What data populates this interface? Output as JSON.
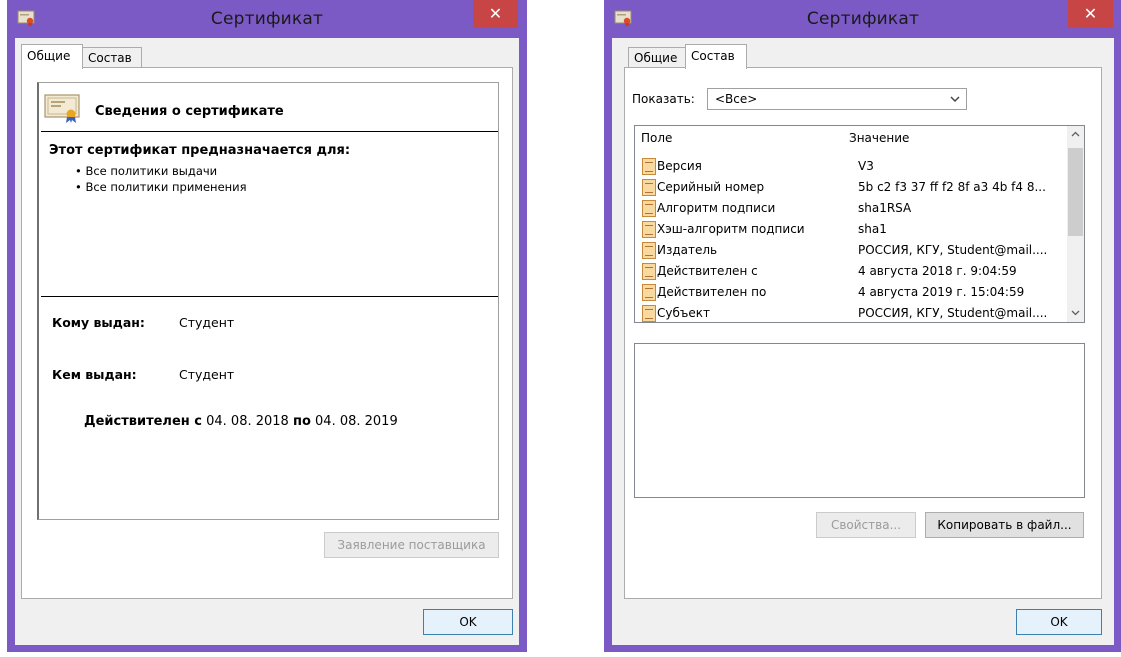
{
  "left_dialog": {
    "title": "Сертификат",
    "close_glyph": "✕",
    "tabs": [
      {
        "label": "Общие",
        "active": true
      },
      {
        "label": "Состав",
        "active": false
      }
    ],
    "info_heading": "Сведения о сертификате",
    "purpose_heading": "Этот сертификат предназначается для:",
    "purposes": [
      "• Все политики выдачи",
      "• Все политики применения"
    ],
    "issued_to_label": "Кому выдан:",
    "issued_to_value": "Студент",
    "issued_by_label": "Кем выдан:",
    "issued_by_value": "Студент",
    "valid_from_label": "Действителен с",
    "valid_from_value": "04. 08. 2018",
    "valid_to_label": "по",
    "valid_to_value": "04. 08. 2019",
    "issuer_statement_button": "Заявление поставщика",
    "ok_button": "OK"
  },
  "right_dialog": {
    "title": "Сертификат",
    "close_glyph": "✕",
    "tabs": [
      {
        "label": "Общие",
        "active": false
      },
      {
        "label": "Состав",
        "active": true
      }
    ],
    "show_label": "Показать:",
    "show_selected": "<Все>",
    "columns": [
      "Поле",
      "Значение"
    ],
    "rows": [
      {
        "field": "Версия",
        "value": "V3"
      },
      {
        "field": "Серийный номер",
        "value": "5b c2 f3 37 ff f2 8f a3 4b f4 8..."
      },
      {
        "field": "Алгоритм подписи",
        "value": "sha1RSA"
      },
      {
        "field": "Хэш-алгоритм подписи",
        "value": "sha1"
      },
      {
        "field": "Издатель",
        "value": "РОССИЯ, КГУ, Student@mail...."
      },
      {
        "field": "Действителен с",
        "value": "4 августа 2018 г. 9:04:59"
      },
      {
        "field": "Действителен по",
        "value": "4 августа 2019 г. 15:04:59"
      },
      {
        "field": "Субъект",
        "value": "РОССИЯ, КГУ, Student@mail...."
      }
    ],
    "properties_button": "Свойства...",
    "copy_button": "Копировать в файл...",
    "ok_button": "OK"
  },
  "colors": {
    "window_frame": "#7b5ac5",
    "close_button": "#c74545",
    "dialog_bg": "#f0f0f0"
  },
  "icons": [
    "certificate-icon",
    "close-icon",
    "chevron-down-icon",
    "chevron-up-icon",
    "field-icon"
  ]
}
